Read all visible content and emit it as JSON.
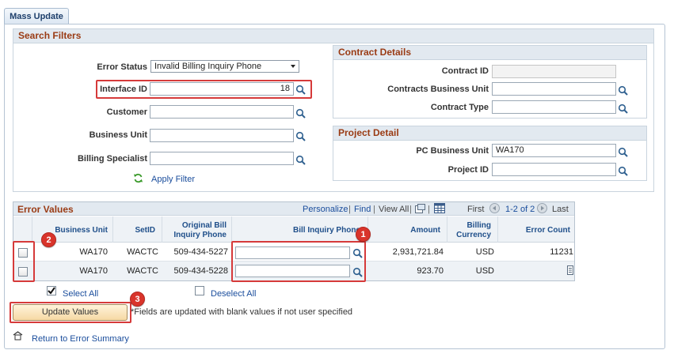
{
  "tab": {
    "label": "Mass Update"
  },
  "search_filters": {
    "title": "Search Filters",
    "error_status": {
      "label": "Error Status",
      "value": "Invalid Billing Inquiry Phone"
    },
    "interface_id": {
      "label": "Interface ID",
      "value": "18"
    },
    "customer": {
      "label": "Customer",
      "value": ""
    },
    "business_unit": {
      "label": "Business Unit",
      "value": ""
    },
    "billing_specialist": {
      "label": "Billing Specialist",
      "value": ""
    },
    "apply_filter": "Apply Filter"
  },
  "contract_details": {
    "title": "Contract Details",
    "contract_id": {
      "label": "Contract ID",
      "value": ""
    },
    "contracts_business_unit": {
      "label": "Contracts Business Unit",
      "value": ""
    },
    "contract_type": {
      "label": "Contract Type",
      "value": ""
    }
  },
  "project_detail": {
    "title": "Project Detail",
    "pc_business_unit": {
      "label": "PC Business Unit",
      "value": "WA170"
    },
    "project_id": {
      "label": "Project ID",
      "value": ""
    }
  },
  "error_values": {
    "title": "Error Values",
    "toolbar": {
      "personalize": "Personalize",
      "find": "Find",
      "view_all": "View All",
      "first": "First",
      "range": "1-2 of 2",
      "last": "Last"
    },
    "columns": {
      "business_unit": "Business Unit",
      "setid": "SetID",
      "original_bill_inquiry_phone": "Original Bill Inquiry Phone",
      "bill_inquiry_phone": "Bill Inquiry Phone",
      "amount": "Amount",
      "billing_currency": "Billing Currency",
      "error_count": "Error Count"
    },
    "rows": [
      {
        "business_unit": "WA170",
        "setid": "WACTC",
        "original_phone": "509-434-5227",
        "phone": "",
        "amount": "2,931,721.84",
        "currency": "USD",
        "error_count": "11231"
      },
      {
        "business_unit": "WA170",
        "setid": "WACTC",
        "original_phone": "509-434-5228",
        "phone": "",
        "amount": "923.70",
        "currency": "USD",
        "error_count": ""
      }
    ],
    "select_all": "Select All",
    "deselect_all": "Deselect All"
  },
  "update_button": "Update Values",
  "update_note": "*Fields are updated with blank values if not user specified",
  "return_link": "Return to Error Summary",
  "badges": {
    "b1": "1",
    "b2": "2",
    "b3": "3"
  },
  "colors": {
    "annotation_red": "#d63a3a",
    "group_title": "#9a3b14",
    "link_blue": "#1a4d9c"
  }
}
